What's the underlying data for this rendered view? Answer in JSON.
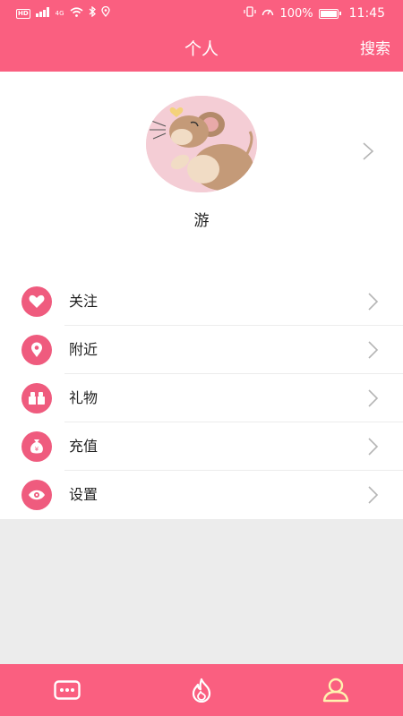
{
  "status_bar": {
    "left_badge": "HD",
    "signal_label": "4G",
    "battery_percent": "100%",
    "time": "11:45"
  },
  "header": {
    "title": "个人",
    "search_label": "搜索"
  },
  "profile": {
    "username": "游"
  },
  "menu": {
    "items": [
      {
        "label": "关注",
        "icon": "heart-icon"
      },
      {
        "label": "附近",
        "icon": "location-pin-icon"
      },
      {
        "label": "礼物",
        "icon": "gift-icon"
      },
      {
        "label": "充值",
        "icon": "money-bag-icon"
      },
      {
        "label": "设置",
        "icon": "eye-icon"
      }
    ]
  },
  "tab_bar": {
    "tabs": [
      {
        "icon": "chat-bubble-icon",
        "active": false
      },
      {
        "icon": "flame-icon",
        "active": false
      },
      {
        "icon": "user-icon",
        "active": true
      }
    ]
  },
  "colors": {
    "brand_pink": "#fa5f80",
    "icon_pink": "#ef5b7e",
    "active_tab_icon": "#fff3b0",
    "page_background": "#ececec"
  }
}
